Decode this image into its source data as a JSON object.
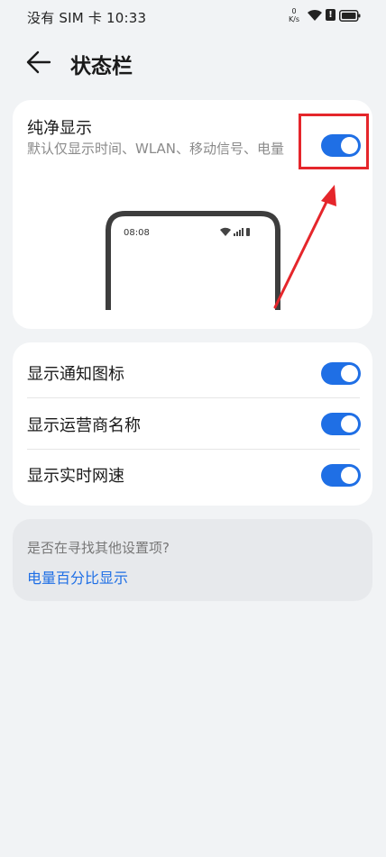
{
  "status_bar": {
    "carrier_time": "没有 SIM 卡 10:33",
    "speed_value": "0",
    "speed_unit": "K/s",
    "alert": "!",
    "icons": [
      "wifi-icon",
      "alert-icon",
      "battery-icon"
    ]
  },
  "header": {
    "title": "状态栏",
    "back_icon": "arrow-left-icon"
  },
  "pure_display": {
    "title": "纯净显示",
    "description": "默认仅显示时间、WLAN、移动信号、电量",
    "enabled": true,
    "preview": {
      "time": "08:08",
      "icons": [
        "wifi-icon",
        "signal-icon",
        "battery-icon"
      ]
    }
  },
  "settings": [
    {
      "label": "显示通知图标",
      "enabled": true
    },
    {
      "label": "显示运营商名称",
      "enabled": true
    },
    {
      "label": "显示实时网速",
      "enabled": true
    }
  ],
  "search_suggestion": {
    "question": "是否在寻找其他设置项?",
    "link": "电量百分比显示"
  },
  "colors": {
    "accent": "#1f6fe5",
    "annotation": "#e5262b",
    "background": "#f1f3f5"
  }
}
